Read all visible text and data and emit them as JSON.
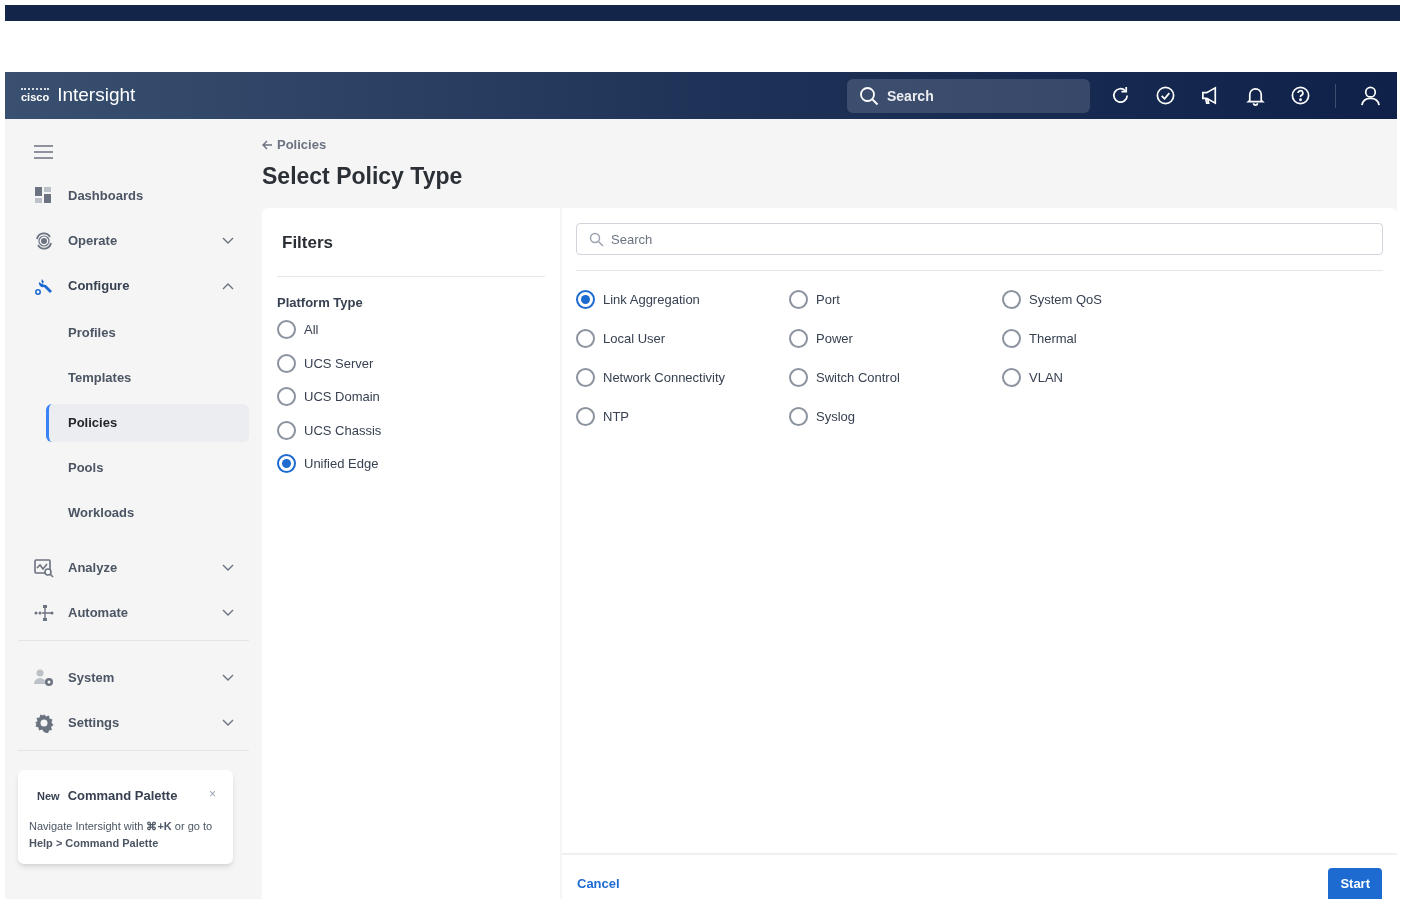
{
  "header": {
    "logo": "cisco",
    "product": "Intersight",
    "search_placeholder": "Search"
  },
  "nav": {
    "sections": [
      [
        {
          "kind": "link",
          "label": "Dashboards",
          "selected": false
        },
        {
          "kind": "group",
          "label": "Operate",
          "selected": false,
          "expanded": false
        },
        {
          "kind": "group",
          "label": "Configure",
          "selected": true,
          "expanded": true,
          "children": [
            {
              "label": "Profiles",
              "selected": false
            },
            {
              "label": "Templates",
              "selected": false
            },
            {
              "label": "Policies",
              "selected": true
            },
            {
              "label": "Pools",
              "selected": false
            },
            {
              "label": "Workloads",
              "selected": false
            }
          ]
        },
        {
          "kind": "group",
          "label": "Analyze",
          "selected": false,
          "expanded": false
        },
        {
          "kind": "group",
          "label": "Automate",
          "selected": false,
          "expanded": false
        }
      ],
      [
        {
          "kind": "group",
          "label": "System",
          "selected": false,
          "expanded": false
        },
        {
          "kind": "group",
          "label": "Settings",
          "selected": false,
          "expanded": false
        }
      ]
    ]
  },
  "tip_card": {
    "badge": "New",
    "title": "Command Palette",
    "close": "×",
    "text": "Navigate Intersight with **⌘+K** or go to **Help > Command Palette**"
  },
  "breadcrumb": "Policies",
  "page_title": "Select Policy Type",
  "filters": {
    "title": "Filters",
    "group_label": "Platform Type",
    "options": [
      {
        "label": "All",
        "selected": false
      },
      {
        "label": "UCS Server",
        "selected": false
      },
      {
        "label": "UCS Domain",
        "selected": false
      },
      {
        "label": "UCS Chassis",
        "selected": false
      },
      {
        "label": "Unified Edge",
        "selected": true
      }
    ]
  },
  "policy_search": {
    "placeholder": "Search"
  },
  "policy_types": [
    {
      "label": "Link Aggregation",
      "selected": true
    },
    {
      "label": "Local User",
      "selected": false
    },
    {
      "label": "Network Connectivity",
      "selected": false
    },
    {
      "label": "NTP",
      "selected": false
    },
    {
      "label": "Port",
      "selected": false
    },
    {
      "label": "Power",
      "selected": false
    },
    {
      "label": "Switch Control",
      "selected": false
    },
    {
      "label": "Syslog",
      "selected": false
    },
    {
      "label": "System QoS",
      "selected": false
    },
    {
      "label": "Thermal",
      "selected": false
    },
    {
      "label": "VLAN",
      "selected": false
    }
  ],
  "footer": {
    "cancel": "Cancel",
    "start": "Start"
  }
}
